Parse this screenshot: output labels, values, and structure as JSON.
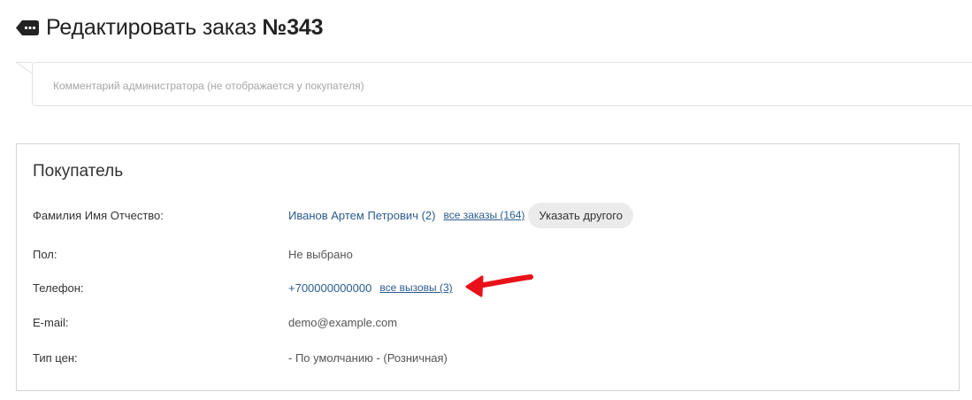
{
  "header": {
    "title_prefix": "Редактировать заказ ",
    "order_number": "№343",
    "back_icon": "back-tag-icon"
  },
  "comment": {
    "placeholder": "Комментарий администратора (не отображается у покупателя)"
  },
  "customer": {
    "title": "Покупатель",
    "rows": [
      {
        "label": "Фамилия Имя Отчество:",
        "value": "Иванов Артем Петрович (2)",
        "link": "все заказы (164)",
        "button": "Указать другого"
      },
      {
        "label": "Пол:",
        "value": "Не выбрано"
      },
      {
        "label": "Телефон:",
        "value": "+700000000000",
        "link": "все вызовы (3)"
      },
      {
        "label": "E-mail:",
        "value": "demo@example.com"
      },
      {
        "label": "Тип цен:",
        "value": "- По умолчанию - (Розничная)"
      }
    ]
  },
  "annotation": {
    "arrow_color": "#e8111a",
    "arrow_icon": "red-arrow-annotation"
  },
  "colors": {
    "link": "#2c5c8f",
    "button_bg": "#ebebeb",
    "panel_border": "#d6d6d6"
  }
}
